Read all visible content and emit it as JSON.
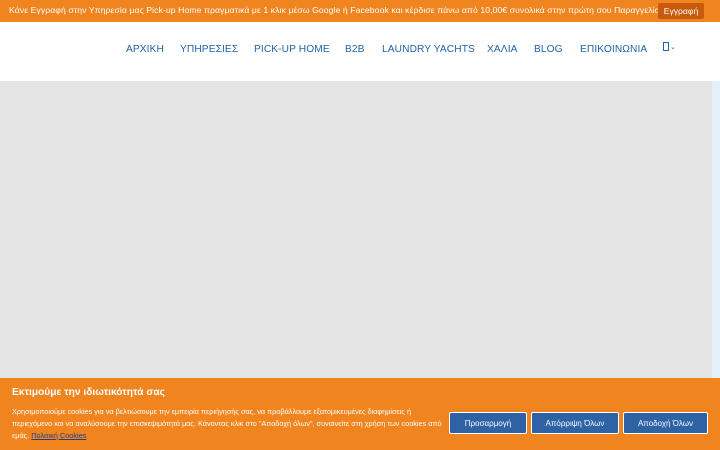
{
  "announcement": {
    "text": "Κάνε Εγγραφή  στην Υπηρεσία μας Pick-up Home πραγματικά με 1 κλικ  μέσω Google ή Facebook και κέρδισε πάνω από 10,00€ συνολικά στην πρώτη σου Παραγγελία!",
    "register_label": "Εγγραφή"
  },
  "nav": {
    "items": [
      {
        "label": "ΑΡΧΙΚΗ"
      },
      {
        "label": "ΥΠΗΡΕΣΙΕΣ"
      },
      {
        "label": "PICK-UP HOME"
      },
      {
        "label": "B2B"
      },
      {
        "label": "LAUNDRY YACHTS"
      },
      {
        "label": "ΧΑΛΙΑ"
      },
      {
        "label": "BLOG"
      },
      {
        "label": "ΕΠΙΚΟΙΝΩΝΙΑ"
      }
    ]
  },
  "cookie_banner": {
    "title": "Εκτιμούμε την ιδιωτικότητά σας",
    "text": "Χρησιμοποιούμε cookies για να βελτιώσουμε την εμπειρία περιήγησής σας, να προβάλλουμε εξατομικευμένες διαφημίσεις ή περιεχόμενο και να αναλύσουμε την επισκεψιμότητά μας. Κάνοντας κλικ στο \"Αποδοχή όλων\", συναινείτε στη χρήση των cookies από εμάς.",
    "policy_link": "Πολιτική Cookies",
    "customize_label": "Προσαρμογή",
    "reject_label": "Απόρριψη Όλων",
    "accept_label": "Αποδοχή Όλων"
  },
  "colors": {
    "accent": "#f0841f",
    "nav_text": "#1f63a7",
    "button": "#2d62a5"
  }
}
